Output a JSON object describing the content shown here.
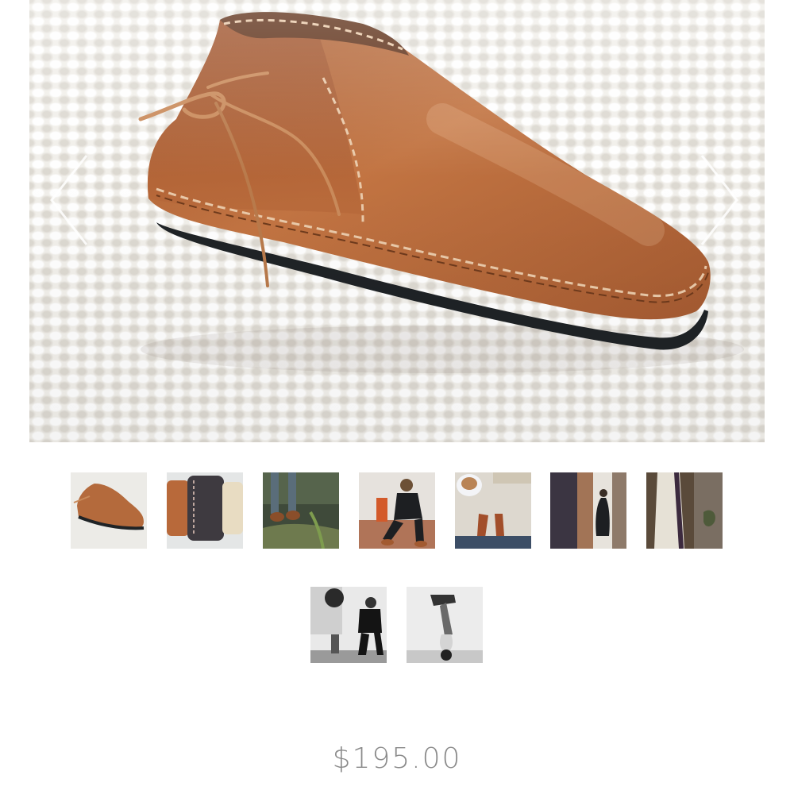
{
  "product": {
    "price": "$195.00",
    "colors": {
      "leather": "#b56a3d",
      "leather_dark": "#8a4a26",
      "sole": "#1f2326",
      "price_text": "#8a8a8a"
    }
  },
  "gallery": {
    "nav_icons": {
      "previous": "chevron-left-icon",
      "next": "chevron-right-icon"
    },
    "thumbnails": [
      "moccasin-tan-side",
      "moccasins-three-colors",
      "moccasins-outdoor-grass",
      "person-seated-wearing-moccasins",
      "feet-with-coffee-cup",
      "person-walking-alley",
      "hanging-bag",
      "person-seated-black-and-white",
      "person-headstand"
    ]
  }
}
